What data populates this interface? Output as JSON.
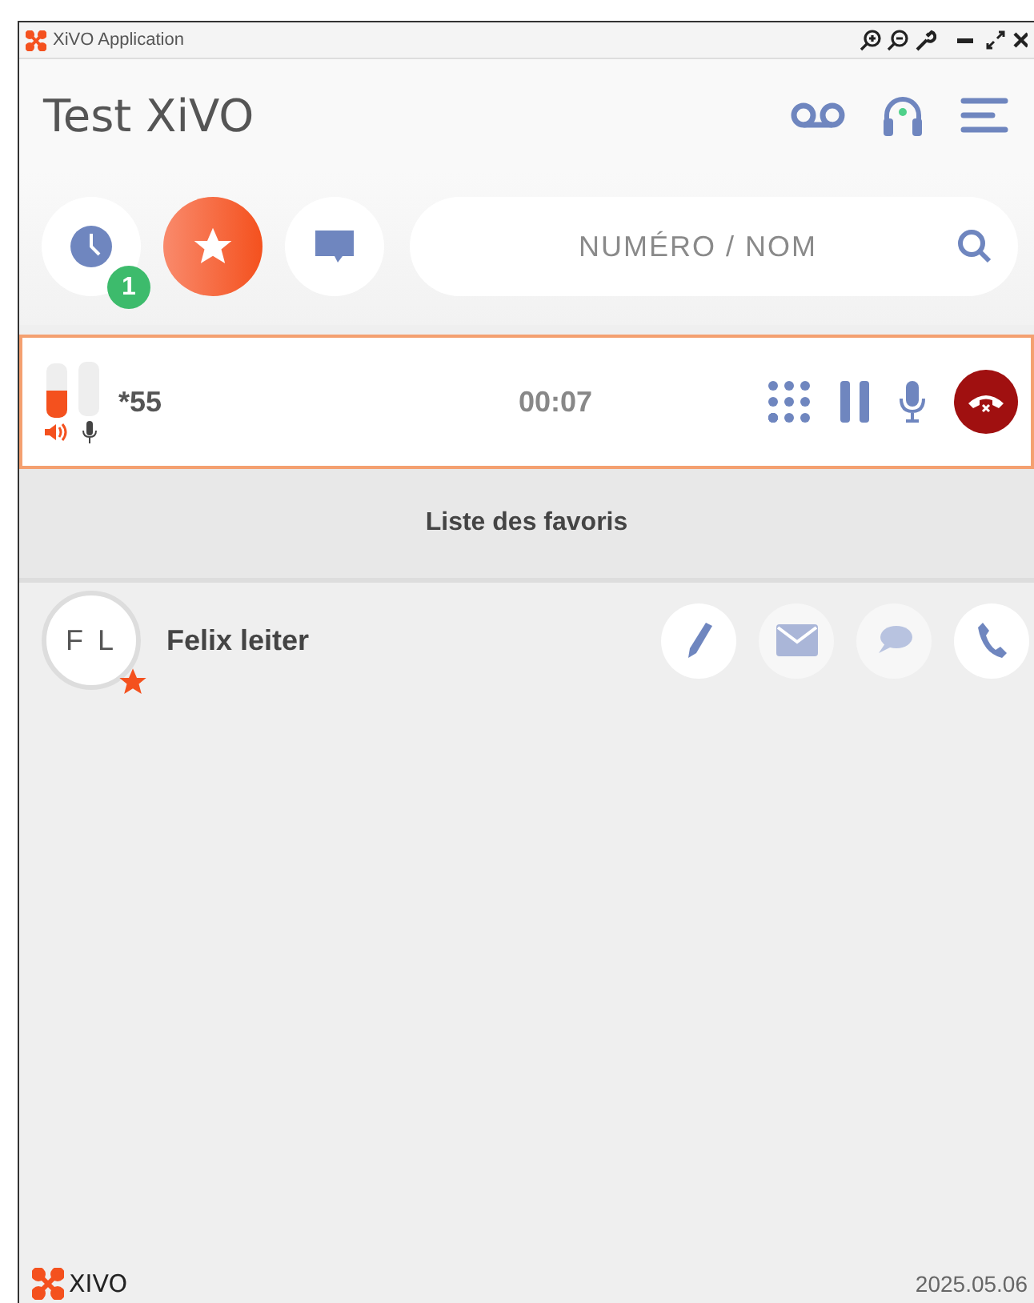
{
  "window": {
    "title": "XiVO Application"
  },
  "header": {
    "title": "Test XiVO"
  },
  "nav": [
    {
      "kind": "history",
      "selected": false,
      "badge": "1"
    },
    {
      "kind": "favorites",
      "selected": true
    },
    {
      "kind": "chat",
      "selected": false
    }
  ],
  "search": {
    "placeholder": "NUMÉRO / NOM"
  },
  "call": {
    "speaker": {
      "level": 0.5
    },
    "mic": {
      "level": 0
    },
    "number": "*55",
    "duration": "00:07"
  },
  "favorites": {
    "heading": "Liste des favoris",
    "contacts": [
      {
        "initials": "F L",
        "name": "Felix leiter",
        "favorite": true
      }
    ]
  },
  "footer": {
    "logo": "XIVO",
    "version": "2025.05.06"
  }
}
